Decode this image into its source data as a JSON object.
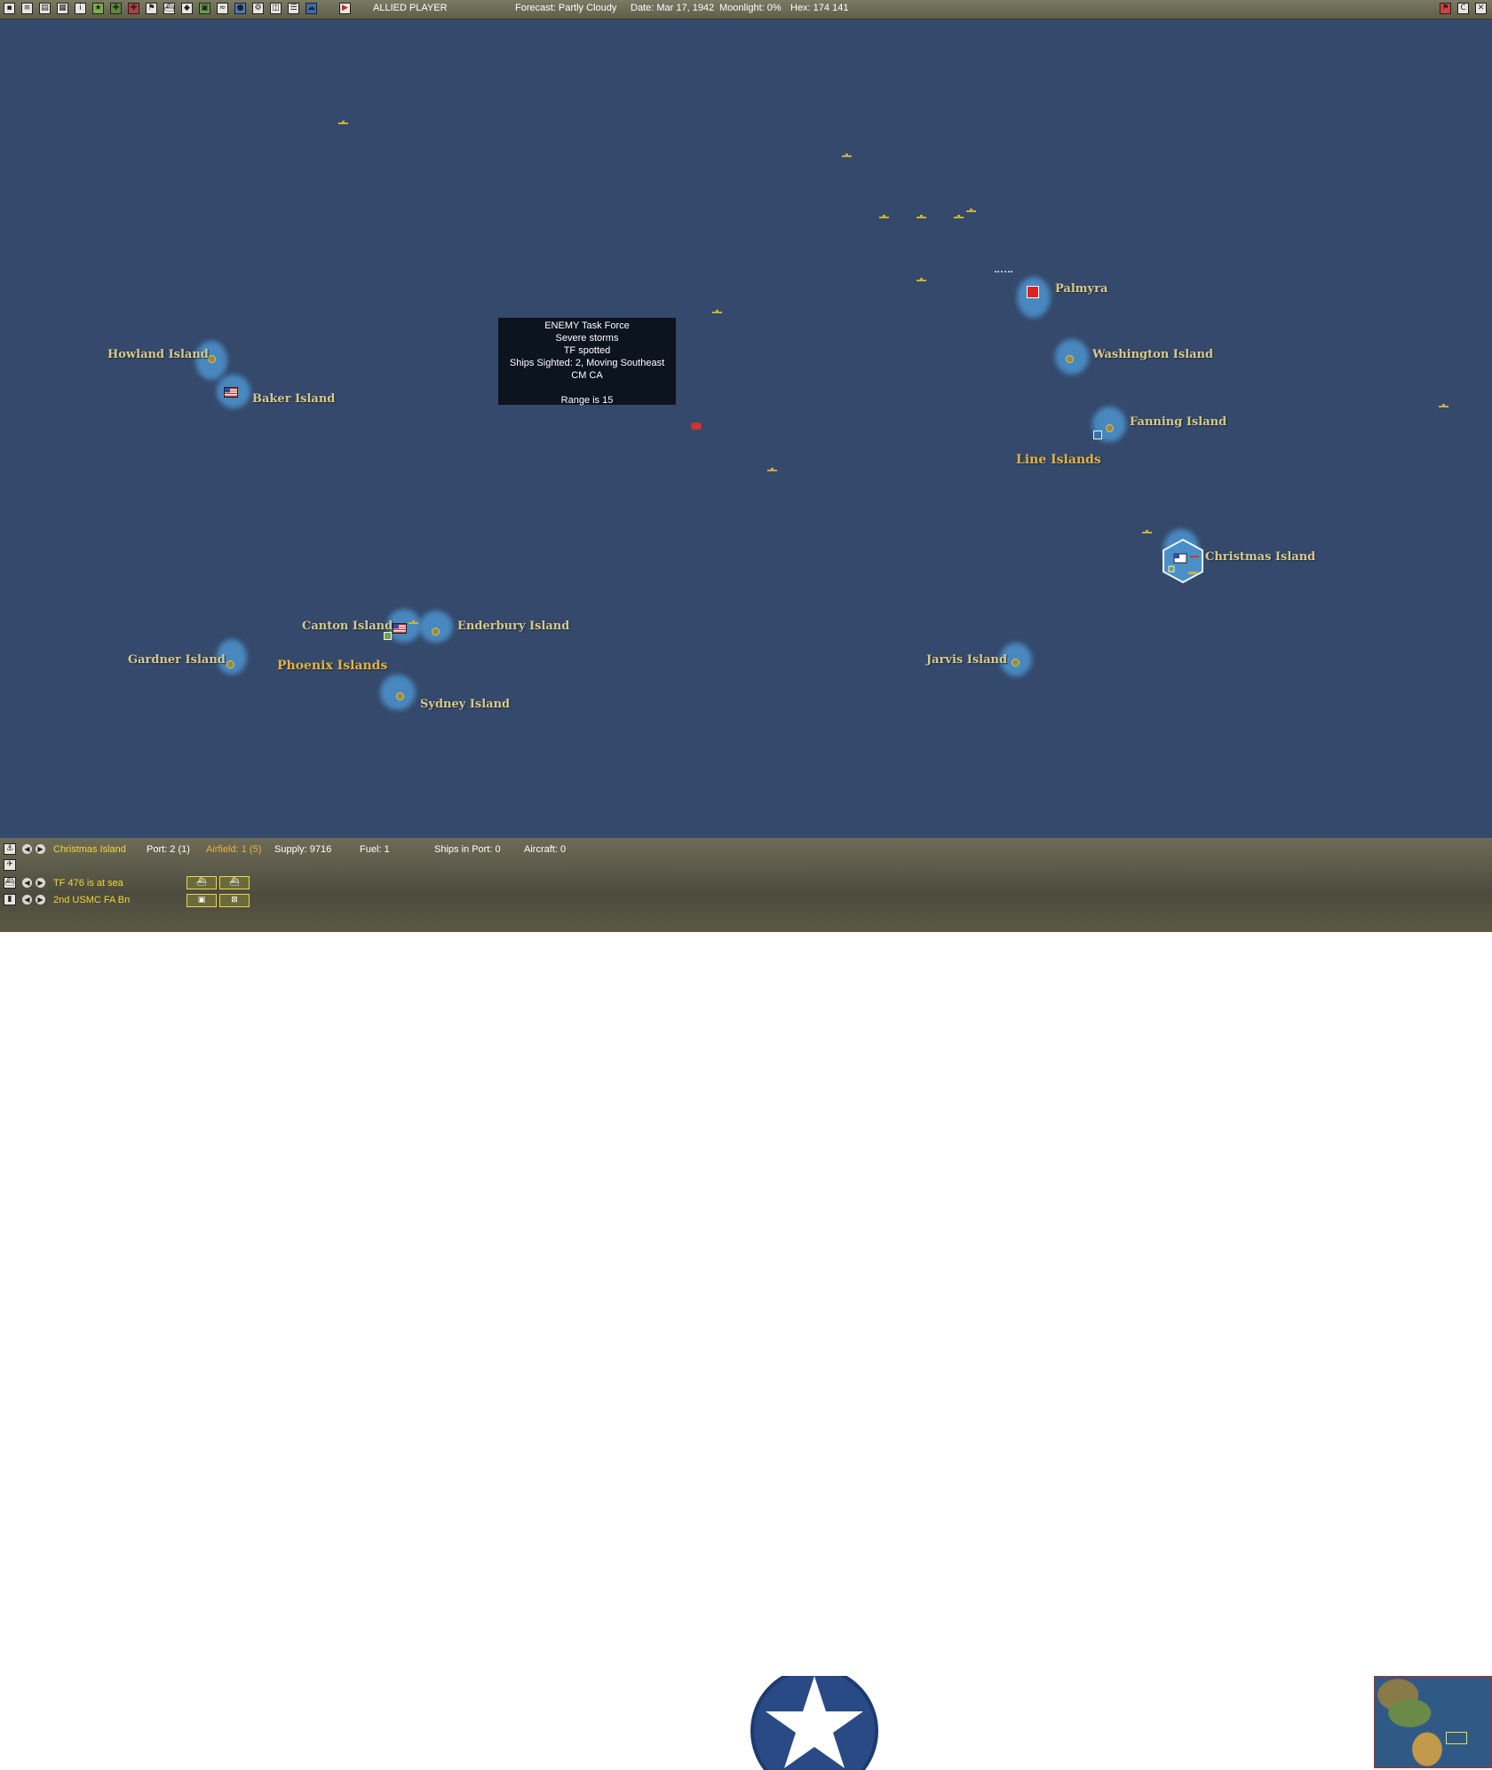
{
  "topbar": {
    "player": "ALLIED PLAYER",
    "forecast": "Forecast: Partly Cloudy",
    "date": "Date: Mar 17, 1942",
    "moonlight": "Moonlight: 0%",
    "hex": "Hex: 174 141"
  },
  "map": {
    "islands": [
      {
        "name": "Howland Island"
      },
      {
        "name": "Baker Island"
      },
      {
        "name": "Palmyra"
      },
      {
        "name": "Washington Island"
      },
      {
        "name": "Fanning Island"
      },
      {
        "name": "Christmas Island"
      },
      {
        "name": "Canton Island"
      },
      {
        "name": "Enderbury Island"
      },
      {
        "name": "Gardner Island"
      },
      {
        "name": "Sydney Island"
      },
      {
        "name": "Jarvis Island"
      }
    ],
    "regions": [
      "Line Islands",
      "Phoenix Islands"
    ]
  },
  "tooltip": {
    "lines": [
      "ENEMY Task Force",
      "Severe storms",
      "TF spotted",
      "Ships Sighted: 2, Moving Southeast",
      "CM CA",
      "",
      "Range is 15"
    ]
  },
  "status": {
    "base_name": "Christmas Island",
    "port": "Port: 2 (1)",
    "airfield": "Airfield: 1 (5)",
    "supply": "Supply: 9716",
    "fuel": "Fuel: 1",
    "ships_in_port": "Ships in Port: 0",
    "aircraft": "Aircraft: 0",
    "task_force": "TF 476 is at sea",
    "unit": "2nd USMC FA Bn"
  },
  "colors": {
    "ocean": "#34496b",
    "reef": "#4b8fc9",
    "label": "#d8c98b",
    "region_label": "#e2b341",
    "status_yellow": "#f0d838"
  }
}
